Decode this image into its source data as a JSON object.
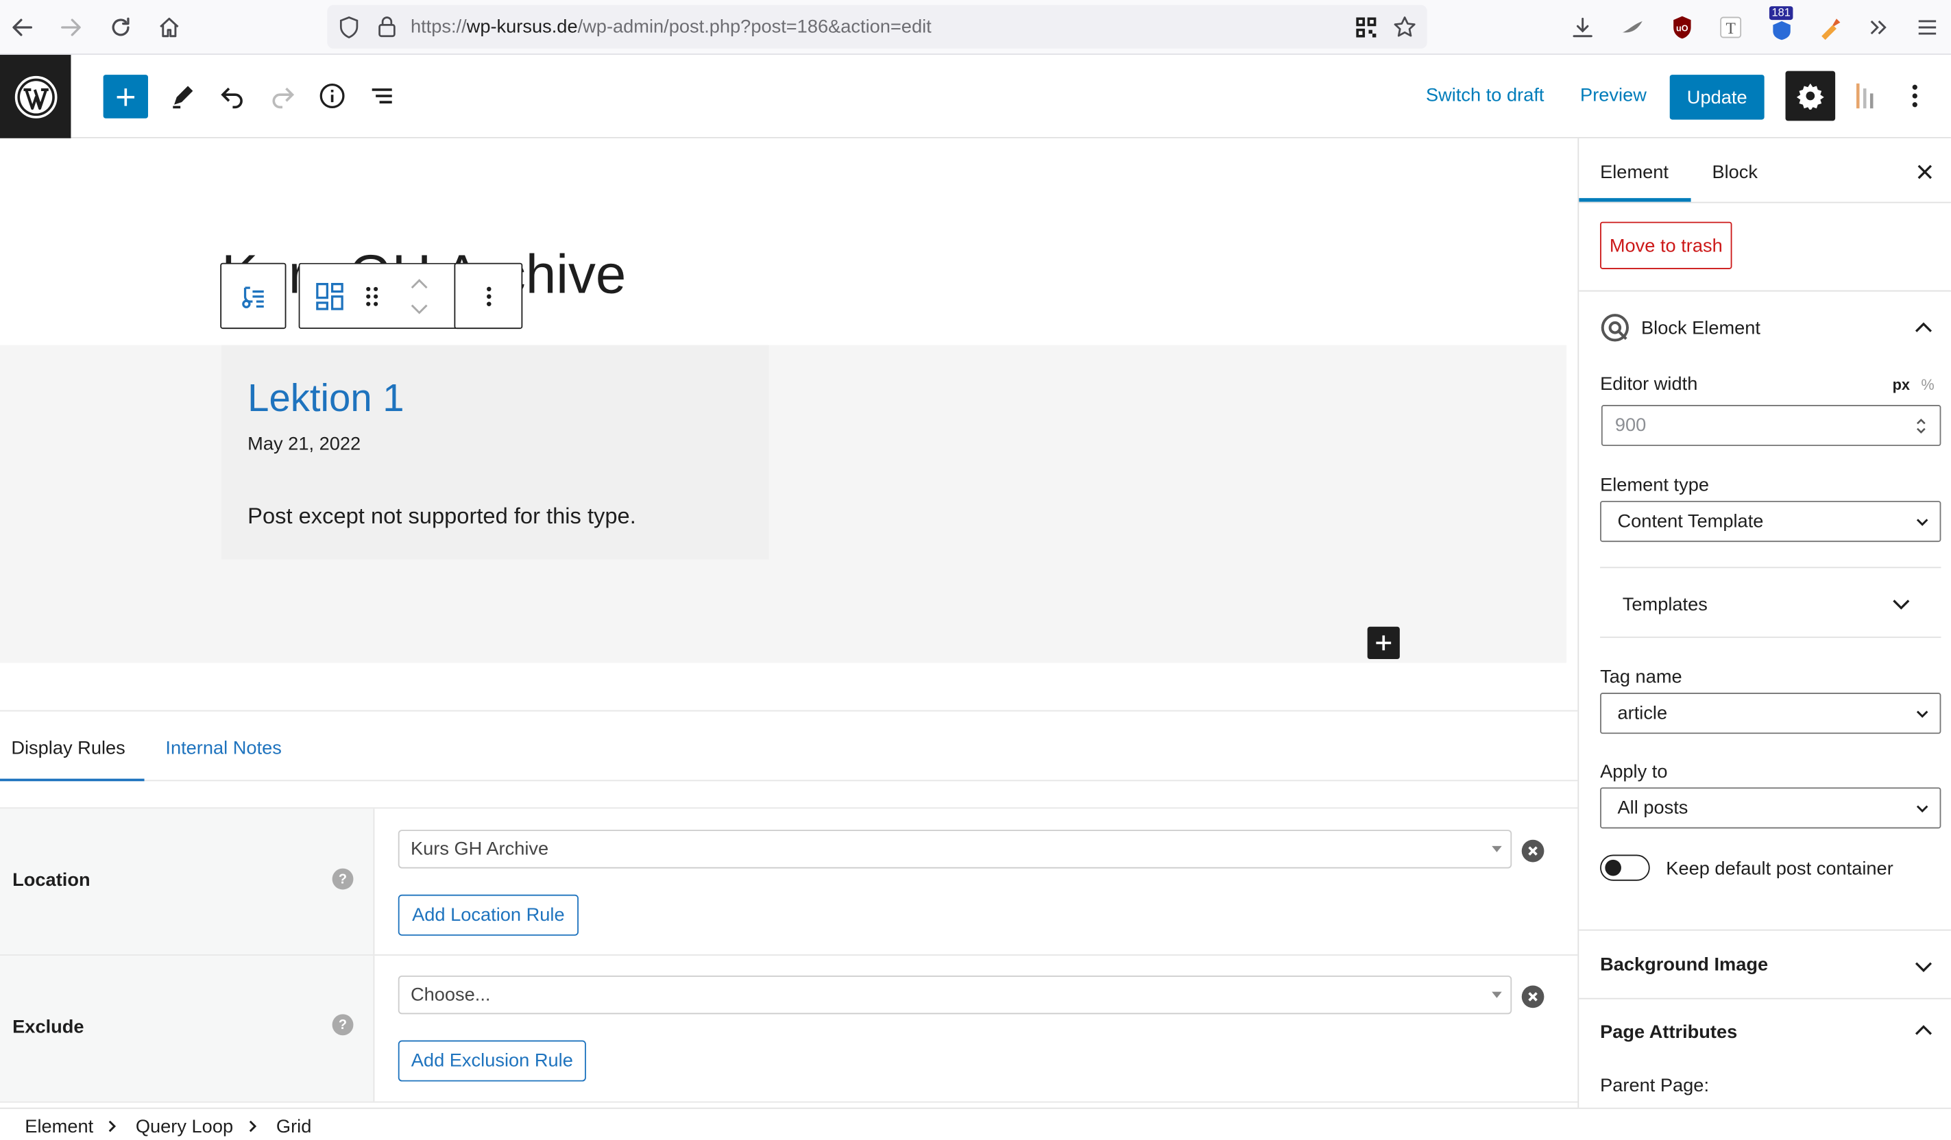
{
  "browser": {
    "url_prefix": "https://",
    "url_domain": "wp-kursus.de",
    "url_path": "/wp-admin/post.php?post=186&action=edit",
    "badge_count": "181"
  },
  "header": {
    "switch_draft": "Switch to draft",
    "preview": "Preview",
    "update": "Update"
  },
  "canvas": {
    "post_title": "Kurs GH Archive",
    "card": {
      "title": "Lektion 1",
      "date": "May 21, 2022",
      "excerpt": "Post except not supported for this type."
    }
  },
  "metabox": {
    "tabs": [
      "Display Rules",
      "Internal Notes"
    ],
    "location": {
      "label": "Location",
      "value": "Kurs GH Archive",
      "add_button": "Add Location Rule"
    },
    "exclude": {
      "label": "Exclude",
      "placeholder": "Choose...",
      "add_button": "Add Exclusion Rule"
    },
    "help_glyph": "?"
  },
  "breadcrumb": [
    "Element",
    "Query Loop",
    "Grid"
  ],
  "sidebar": {
    "tabs": [
      "Element",
      "Block"
    ],
    "move_to_trash": "Move to trash",
    "block_element_title": "Block Element",
    "editor_width": {
      "label": "Editor width",
      "units": [
        "px",
        "%"
      ],
      "value": "900"
    },
    "element_type": {
      "label": "Element type",
      "value": "Content Template"
    },
    "templates": "Templates",
    "tag_name": {
      "label": "Tag name",
      "value": "article"
    },
    "apply_to": {
      "label": "Apply to",
      "value": "All posts"
    },
    "keep_container": {
      "label": "Keep default post container",
      "enabled": false
    },
    "background_image": "Background Image",
    "page_attributes": "Page Attributes",
    "parent_page": "Parent Page:"
  },
  "colors": {
    "wp_blue": "#007cba",
    "link_blue": "#1e73be",
    "danger": "#cc1818",
    "dark": "#1e1e1e"
  }
}
